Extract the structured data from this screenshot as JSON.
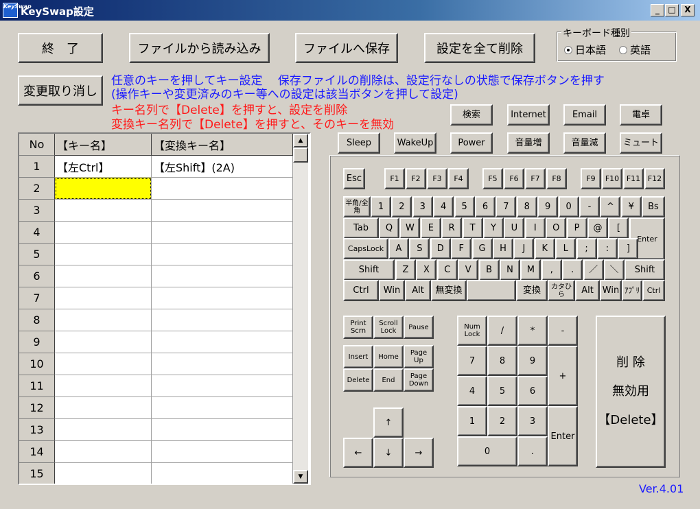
{
  "window": {
    "title": "KeySwap設定",
    "icon_label": "KeySwap",
    "controls": {
      "minimize": "_",
      "maximize": "□",
      "close": "X"
    }
  },
  "toolbar": {
    "exit": "終　了",
    "load": "ファイルから読み込み",
    "save": "ファイルへ保存",
    "delete_all": "設定を全て削除",
    "undo": "変更取り消し"
  },
  "keyboard_type": {
    "title": "キーボード種別",
    "options": [
      "日本語",
      "英語"
    ],
    "selected": "日本語"
  },
  "info": {
    "line1": "任意のキーを押してキー設定　 保存ファイルの削除は、設定行なしの状態で保存ボタンを押す",
    "line2": "(操作キーや変更済みのキー等への設定は該当ボタンを押して設定)",
    "line3": "キー名列で【Delete】を押すと、設定を削除",
    "line4": "変換キー名列で【Delete】を押すと、そのキーを無効"
  },
  "grid": {
    "headers": {
      "no": "No",
      "key": "【キー名】",
      "swap": "【変換キー名】"
    },
    "rows": [
      {
        "no": "1",
        "key": "【左Ctrl】",
        "swap": "【左Shift】(2A)"
      },
      {
        "no": "2",
        "key": "",
        "swap": ""
      },
      {
        "no": "3",
        "key": "",
        "swap": ""
      },
      {
        "no": "4",
        "key": "",
        "swap": ""
      },
      {
        "no": "5",
        "key": "",
        "swap": ""
      },
      {
        "no": "6",
        "key": "",
        "swap": ""
      },
      {
        "no": "7",
        "key": "",
        "swap": ""
      },
      {
        "no": "8",
        "key": "",
        "swap": ""
      },
      {
        "no": "9",
        "key": "",
        "swap": ""
      },
      {
        "no": "10",
        "key": "",
        "swap": ""
      },
      {
        "no": "11",
        "key": "",
        "swap": ""
      },
      {
        "no": "12",
        "key": "",
        "swap": ""
      },
      {
        "no": "13",
        "key": "",
        "swap": ""
      },
      {
        "no": "14",
        "key": "",
        "swap": ""
      },
      {
        "no": "15",
        "key": "",
        "swap": ""
      }
    ],
    "selected_cell_color": "#ffff00"
  },
  "special_keys": {
    "row1": [
      "検索",
      "Internet",
      "Email",
      "電卓"
    ],
    "row2": [
      "Sleep",
      "WakeUp",
      "Power",
      "音量増",
      "音量減",
      "ミュート"
    ]
  },
  "keyboard": {
    "esc": "Esc",
    "fkeys": [
      "F1",
      "F2",
      "F3",
      "F4",
      "F5",
      "F6",
      "F7",
      "F8",
      "F9",
      "F10",
      "F11",
      "F12"
    ],
    "num_row": [
      "半角/全角",
      "1",
      "2",
      "3",
      "4",
      "5",
      "6",
      "7",
      "8",
      "9",
      "0",
      "-",
      "^",
      "¥",
      "Bs"
    ],
    "tab_row": [
      "Tab",
      "Q",
      "W",
      "E",
      "R",
      "T",
      "Y",
      "U",
      "I",
      "O",
      "P",
      "@",
      "["
    ],
    "enter": "Enter",
    "caps_row": [
      "CapsLock",
      "A",
      "S",
      "D",
      "F",
      "G",
      "H",
      "J",
      "K",
      "L",
      ";",
      ":",
      "]"
    ],
    "shift_row": [
      "Shift",
      "Z",
      "X",
      "C",
      "V",
      "B",
      "N",
      "M",
      ",",
      ".",
      "／",
      "＼",
      "Shift"
    ],
    "ctrl_row": [
      "Ctrl",
      "Win",
      "Alt",
      "無変換",
      "",
      "変換",
      "カタひら",
      "Alt",
      "Win",
      "ｱﾌﾟﾘ",
      "Ctrl"
    ],
    "nav": [
      "Print Scrn",
      "Scroll Lock",
      "Pause",
      "Insert",
      "Home",
      "Page Up",
      "Delete",
      "End",
      "Page Down"
    ],
    "arrows": [
      "↑",
      "←",
      "↓",
      "→"
    ],
    "numpad": [
      "Num Lock",
      "/",
      "*",
      "-",
      "7",
      "8",
      "9",
      "+",
      "4",
      "5",
      "6",
      "1",
      "2",
      "3",
      "Enter",
      "0",
      "."
    ],
    "delete_panel": {
      "line1": "削 除",
      "line2": "無効用",
      "line3": "【Delete】"
    }
  },
  "version": "Ver.4.01"
}
